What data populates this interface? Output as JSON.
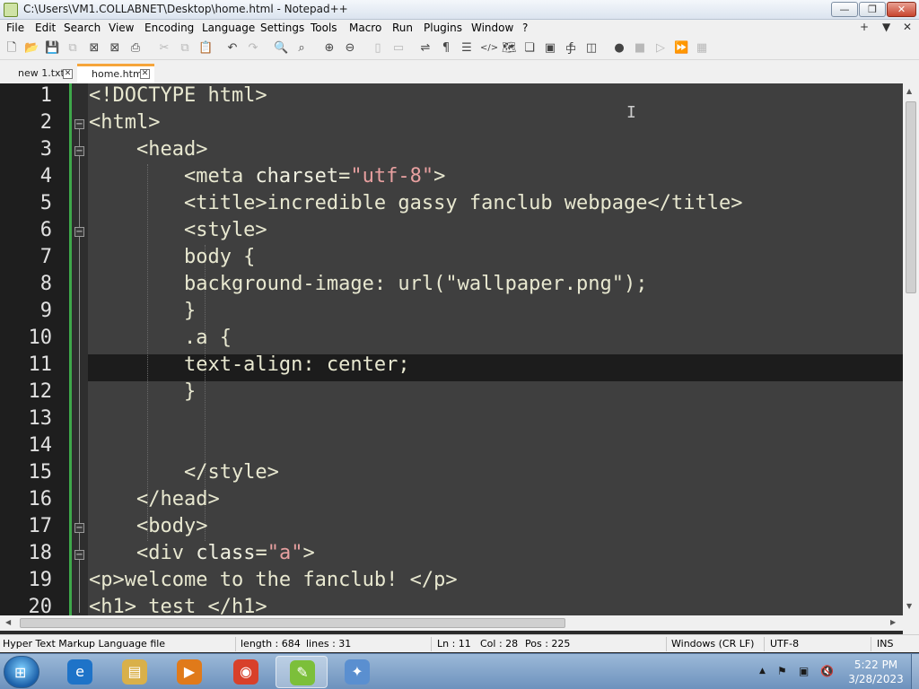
{
  "window": {
    "title": "C:\\Users\\VM1.COLLABNET\\Desktop\\home.html - Notepad++",
    "min_label": "—",
    "max_label": "❐",
    "close_label": "✕"
  },
  "menu": {
    "items": [
      "File",
      "Edit",
      "Search",
      "View",
      "Encoding",
      "Language",
      "Settings",
      "Tools",
      "Macro",
      "Run",
      "Plugins",
      "Window",
      "?"
    ],
    "right": [
      "+",
      "▼",
      "✕"
    ]
  },
  "toolbar": {
    "icons": [
      "new-file-icon",
      "open-file-icon",
      "save-icon",
      "save-all-icon",
      "close-icon",
      "close-all-icon",
      "print-icon",
      "cut-icon",
      "copy-icon",
      "paste-icon",
      "undo-icon",
      "redo-icon",
      "find-icon",
      "replace-icon",
      "zoom-in-icon",
      "zoom-out-icon",
      "sync-v-icon",
      "sync-h-icon",
      "word-wrap-icon",
      "show-all-chars-icon",
      "indent-guide-icon",
      "xml-tag-icon",
      "doc-map-icon",
      "function-list-icon",
      "folder-workspace-icon",
      "fx-icon",
      "monitor-icon",
      "screenshot-icon",
      "record-macro-icon",
      "stop-macro-icon",
      "play-macro-icon",
      "run-multiple-icon",
      "save-macro-icon"
    ]
  },
  "tabs": [
    {
      "label": "new 1.txt",
      "close": "✕",
      "active": false
    },
    {
      "label": "home.html",
      "close": "✕",
      "active": true
    }
  ],
  "editor": {
    "line_numbers": [
      "1",
      "2",
      "3",
      "4",
      "5",
      "6",
      "7",
      "8",
      "9",
      "10",
      "11",
      "12",
      "13",
      "14",
      "15",
      "16",
      "17",
      "18",
      "19",
      "20"
    ],
    "lines": [
      {
        "parts": [
          {
            "t": "<!DOCTYPE html>",
            "c": "tag"
          }
        ]
      },
      {
        "parts": [
          {
            "t": "<html>",
            "c": "tag"
          }
        ]
      },
      {
        "parts": [
          {
            "t": "    <head>",
            "c": "tag"
          }
        ]
      },
      {
        "parts": [
          {
            "t": "        <meta ",
            "c": "tag"
          },
          {
            "t": "charset",
            "c": "attr"
          },
          {
            "t": "=",
            "c": "tag"
          },
          {
            "t": "\"utf-8\"",
            "c": "str"
          },
          {
            "t": ">",
            "c": "tag"
          }
        ]
      },
      {
        "parts": [
          {
            "t": "        <title>incredible gassy fanclub webpage</title>",
            "c": "tag"
          }
        ]
      },
      {
        "parts": [
          {
            "t": "        <style>",
            "c": "tag"
          }
        ]
      },
      {
        "parts": [
          {
            "t": "        body {",
            "c": "tag"
          }
        ]
      },
      {
        "parts": [
          {
            "t": "        background-image: url(\"wallpaper.png\");",
            "c": "tag"
          }
        ]
      },
      {
        "parts": [
          {
            "t": "        }",
            "c": "tag"
          }
        ]
      },
      {
        "parts": [
          {
            "t": "        .a {",
            "c": "tag"
          }
        ]
      },
      {
        "parts": [
          {
            "t": "        text-align: center;",
            "c": "tag"
          }
        ]
      },
      {
        "parts": [
          {
            "t": "        }",
            "c": "tag"
          }
        ]
      },
      {
        "parts": [
          {
            "t": "",
            "c": "tag"
          }
        ]
      },
      {
        "parts": [
          {
            "t": "",
            "c": "tag"
          }
        ]
      },
      {
        "parts": [
          {
            "t": "        </style>",
            "c": "tag"
          }
        ]
      },
      {
        "parts": [
          {
            "t": "    </head>",
            "c": "tag"
          }
        ]
      },
      {
        "parts": [
          {
            "t": "    <body>",
            "c": "tag"
          }
        ]
      },
      {
        "parts": [
          {
            "t": "    <div ",
            "c": "tag"
          },
          {
            "t": "class",
            "c": "attr"
          },
          {
            "t": "=",
            "c": "tag"
          },
          {
            "t": "\"a\"",
            "c": "str"
          },
          {
            "t": ">",
            "c": "tag"
          }
        ]
      },
      {
        "parts": [
          {
            "t": "<p>welcome to the fanclub! </p>",
            "c": "tag"
          }
        ]
      },
      {
        "parts": [
          {
            "t": "<h1> test </h1>",
            "c": "tag"
          }
        ]
      }
    ],
    "fold_markers": [
      {
        "line": 2,
        "symbol": "⊟"
      },
      {
        "line": 3,
        "symbol": "⊟"
      },
      {
        "line": 6,
        "symbol": "⊟"
      },
      {
        "line": 17,
        "symbol": "⊟"
      },
      {
        "line": 18,
        "symbol": "⊟"
      }
    ],
    "current_line": 11,
    "mouse_cursor": "I"
  },
  "status": {
    "file_type": "Hyper Text Markup Language file",
    "length": "length : 684",
    "lines": "lines : 31",
    "ln": "Ln : 11",
    "col": "Col : 28",
    "pos": "Pos : 225",
    "eol": "Windows (CR LF)",
    "encoding": "UTF-8",
    "mode": "INS"
  },
  "taskbar": {
    "start_glyph": "⊞",
    "apps": [
      {
        "name": "internet-explorer",
        "glyph": "e",
        "color": "#1e73c8"
      },
      {
        "name": "file-explorer",
        "glyph": "▤",
        "color": "#d9b04a"
      },
      {
        "name": "media-player",
        "glyph": "▶",
        "color": "#e07a1a"
      },
      {
        "name": "chrome",
        "glyph": "◉",
        "color": "#d8402a"
      },
      {
        "name": "notepad-plus-plus",
        "glyph": "✎",
        "color": "#7cbf3a"
      },
      {
        "name": "paint",
        "glyph": "✦",
        "color": "#5a8fd0"
      }
    ],
    "active_app": "notepad-plus-plus",
    "tray_icons": [
      "▲",
      "⚑",
      "▣",
      "🔇"
    ],
    "time": "5:22 PM",
    "date": "3/28/2023"
  },
  "colors": {
    "editor_bg": "#3f3f3f",
    "current_line_bg": "#1c1c1c",
    "string": "#e8a0a0",
    "tab_accent": "#f6a53a",
    "modified_bar": "#3ea84a"
  }
}
